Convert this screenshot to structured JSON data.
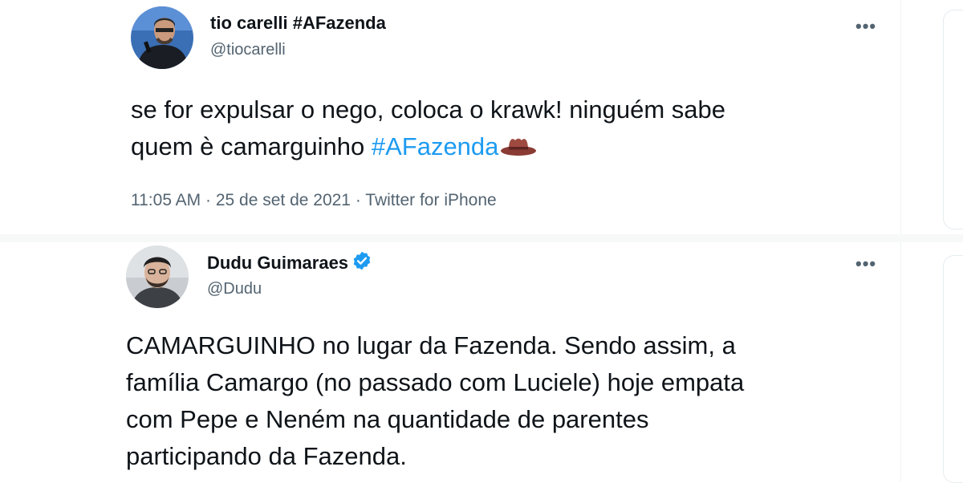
{
  "tweets": [
    {
      "display_name": "tio carelli #AFazenda",
      "handle": "@tiocarelli",
      "verified": false,
      "text_before": "se for expulsar o nego, coloca o krawk! ninguém sabe\nquem è camarguinho ",
      "hashtag": "#AFazenda",
      "emoji": "cowboy-hat",
      "time": "11:05 AM",
      "date": "25 de set de 2021",
      "source": "Twitter for iPhone",
      "more_label": "•••"
    },
    {
      "display_name": "Dudu Guimaraes",
      "handle": "@Dudu",
      "verified": true,
      "text": "CAMARGUINHO no lugar da Fazenda. Sendo assim, a\nfamília Camargo (no passado com Luciele) hoje empata\ncom Pepe e Neném na quantidade de parentes\nparticipando da Fazenda.",
      "more_label": "•••"
    }
  ],
  "colors": {
    "text": "#0f1419",
    "secondary": "#536471",
    "link": "#1d9bf0",
    "verified": "#1d9bf0"
  },
  "meta_separator": " · "
}
